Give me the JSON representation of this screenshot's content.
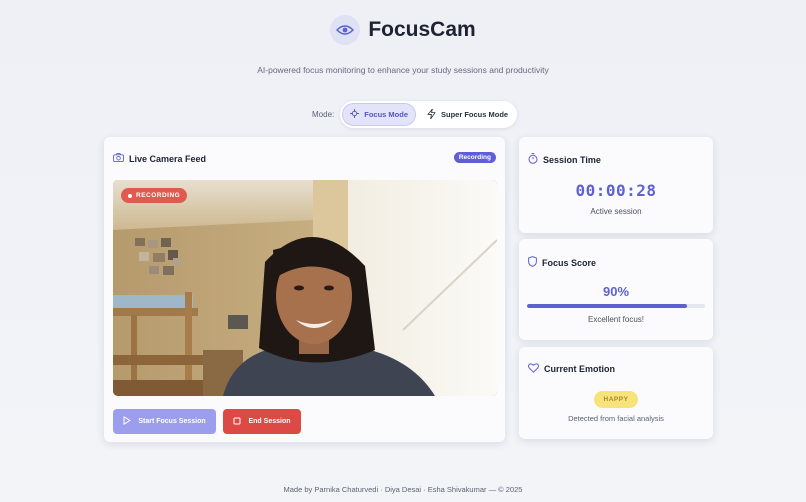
{
  "app": {
    "title": "FocusCam",
    "subtitle": "AI-powered focus monitoring to enhance your study sessions and productivity"
  },
  "mode": {
    "label": "Mode:",
    "options": [
      {
        "label": "Focus Mode",
        "active": true
      },
      {
        "label": "Super Focus Mode",
        "active": false
      }
    ]
  },
  "camera": {
    "title": "Live Camera Feed",
    "status_badge": "Recording",
    "recording_chip": "RECORDING",
    "start_button": "Start Focus Session",
    "end_button": "End Session"
  },
  "session": {
    "title": "Session Time",
    "time": "00:00:28",
    "status": "Active session"
  },
  "focus": {
    "title": "Focus Score",
    "score": "90%",
    "score_fraction": 0.9,
    "message": "Excellent focus!"
  },
  "emotion": {
    "title": "Current Emotion",
    "value": "HAPPY",
    "caption": "Detected from facial analysis"
  },
  "footer": {
    "text": "Made by Parnika Chaturvedi · Diya Desai · Esha Shivakumar — © 2025"
  },
  "colors": {
    "accent": "#5d62d0",
    "recording_red": "#dc4a45",
    "happy_yellow": "#f8e27a"
  }
}
